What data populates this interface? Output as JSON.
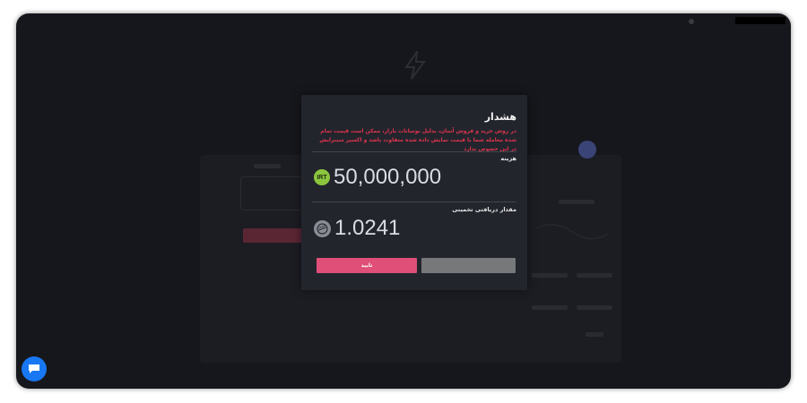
{
  "modal": {
    "title": "هشدار",
    "warning": "در روش خرید و فروش آسان، بدلیل نوسانات بازار، ممکن است قیمت تمام شده معامله شما با قیمت نمایش داده شده متفاوت باشد و اکسپر سیبرایش در این خصوص ندارد",
    "cost_label": "هزینه",
    "cost_currency_icon": "IRT",
    "cost_value": "50,000,000",
    "receive_label": "مقدار دریافتی تخمینی",
    "receive_value": "1.0241",
    "confirm_label": "تایید",
    "cancel_label": ""
  },
  "icons": {
    "cost": "irt-currency-icon",
    "receive": "crypto-coin-icon",
    "chat": "chat-bubble-icon",
    "logo": "lightning-logo-icon"
  },
  "colors": {
    "accent": "#df4f77",
    "warning": "#e0344d",
    "irt": "#8cc63e",
    "chat": "#1877f2"
  }
}
